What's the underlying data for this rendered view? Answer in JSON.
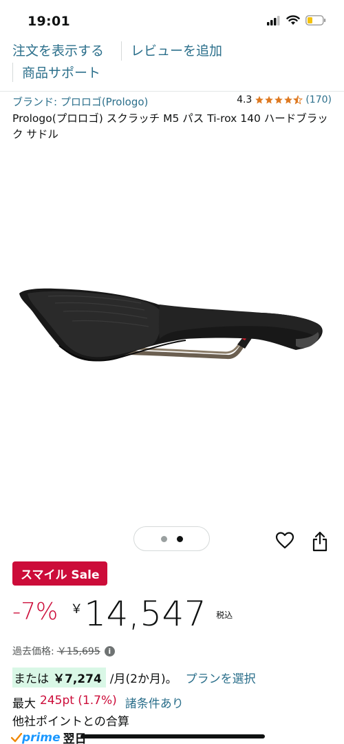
{
  "status_bar": {
    "time": "19:01"
  },
  "links": {
    "view_order": "注文を表示する",
    "add_review": "レビューを追加",
    "product_support": "商品サポート"
  },
  "product": {
    "brand": "ブランド: プロロゴ(Prologo)",
    "rating_value": "4.3",
    "rating_stars": 4.3,
    "rating_count": "(170)",
    "title": "Prologo(プロロゴ) スクラッチ M5 パス Ti-rox 140 ハードブラック サドル",
    "image_icon": "bicycle-saddle-image",
    "image_count": 2,
    "image_active": 2
  },
  "pricing": {
    "badge": "スマイル Sale",
    "discount": "-7%",
    "currency": "￥",
    "price": "14,547",
    "tax_label": "税込",
    "past_label": "過去価格:",
    "past_price": "￥15,695",
    "installment_prefix": "または",
    "installment_amount": "￥7,274",
    "installment_period": "/月(2か月)。",
    "plan_link": "プランを選択",
    "points_prefix": "最大",
    "points_value": "245pt (1.7%)",
    "points_conditions": "諸条件あり",
    "points_note": "他社ポイントとの合算",
    "prime_label": "prime",
    "prime_delivery": "翌日"
  },
  "colors": {
    "link": "#2b6f8b",
    "sale_red": "#cc0c39",
    "star": "#de7921",
    "installment_bg": "#d9f7e6",
    "prime_blue": "#1a98ff"
  }
}
